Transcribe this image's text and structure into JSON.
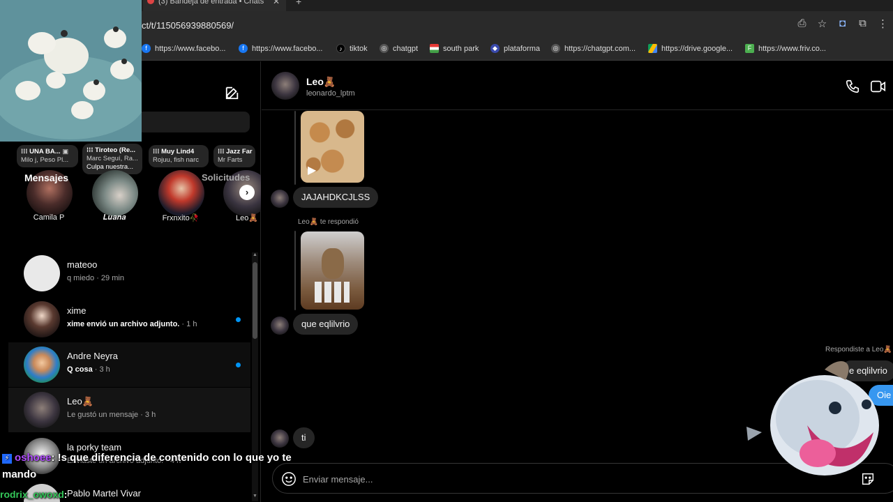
{
  "browser": {
    "tab_title": "(3) Bandeja de entrada • Chats",
    "url": "ct/t/115056939880569/",
    "bookmarks": [
      {
        "label": "https://www.facebo...",
        "icon": "facebook-icon",
        "color": "#1877f2"
      },
      {
        "label": "https://www.facebo...",
        "icon": "facebook-icon",
        "color": "#1877f2"
      },
      {
        "label": "tiktok",
        "icon": "tiktok-icon",
        "color": "#000000"
      },
      {
        "label": "chatgpt",
        "icon": "chatgpt-icon",
        "color": "#555555"
      },
      {
        "label": "south park",
        "icon": "flag-icon",
        "color": "#e53935"
      },
      {
        "label": "plataforma",
        "icon": "platform-icon",
        "color": "#3949ab"
      },
      {
        "label": "https://chatgpt.com...",
        "icon": "chatgpt-icon",
        "color": "#555555"
      },
      {
        "label": "https://drive.google...",
        "icon": "drive-icon",
        "color": "#fbbc04"
      },
      {
        "label": "https://www.friv.co...",
        "icon": "friv-icon",
        "color": "#4caf50"
      }
    ]
  },
  "sidebar": {
    "stories": [
      {
        "note_title": "UNA BA...",
        "note_sub": "Milo j, Peso Pl...",
        "name": "Camila P"
      },
      {
        "note_title": "Tiroteo (Re...",
        "note_sub": "Marc Seguí, Ra...",
        "note_extra": "Culpa nuestra...",
        "name": "𝑳𝒖𝒂𝒏𝒂"
      },
      {
        "note_title": "Muy Lind4",
        "note_sub": "Rojuu, fish narc",
        "name": "Frxnxito🥀"
      },
      {
        "note_title": "Jazz Far",
        "note_sub": "Mr Farts",
        "name": "Leo🧸"
      }
    ],
    "messages_label": "Mensajes",
    "requests_label": "Solicitudes",
    "conversations": [
      {
        "name": "mateoo",
        "preview": "q miedo",
        "time": " · 29 min",
        "unread": false
      },
      {
        "name": "xime",
        "preview": "xime envió un archivo adjunto.",
        "time": " · 1 h",
        "unread": true
      },
      {
        "name": "Andre Neyra",
        "preview": "Q cosa",
        "time": " · 3 h",
        "unread": true
      },
      {
        "name": "Leo🧸",
        "preview": "Le gustó un mensaje",
        "time": " · 3 h",
        "unread": false
      },
      {
        "name": "la porky team",
        "preview": "Enviaste un archivo adjunto.",
        "time": " · 4 h",
        "unread": false
      },
      {
        "name": "Pablo Martel Vivar",
        "preview": "",
        "time": "",
        "unread": false
      }
    ]
  },
  "chat": {
    "contact_name": "Leo🧸",
    "contact_username": "leonardo_lptm",
    "messages": [
      {
        "text": "JAJAHDKCJLSS"
      },
      {
        "text": "que eqlilvrio"
      },
      {
        "text": "ti"
      }
    ],
    "reply_label": "Leo🧸 te respondió",
    "sent_reply_label": "Respondiste a Leo🧸",
    "sent_reply_quote": "e eqlilvrio",
    "sent_partial": "Oie s",
    "composer_placeholder": "Enviar mensaje..."
  },
  "stream_chat": {
    "line1_user": "oshoee",
    "line1_text": ": !s que diferencia de contenido con lo que yo te",
    "line2_text": "mando",
    "line3_user": "rodrix_owoxd",
    "line3_text": ": "
  },
  "colors": {
    "accent": "#0095f6",
    "bubble": "#262626",
    "background": "#000000"
  }
}
